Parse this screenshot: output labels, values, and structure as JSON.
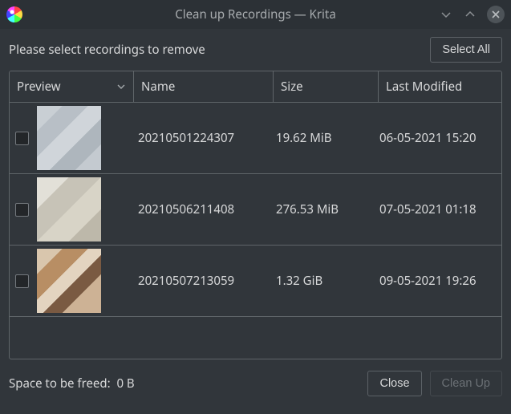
{
  "window": {
    "title": "Clean up Recordings — Krita"
  },
  "ui": {
    "instruction": "Please select recordings to remove",
    "select_all": "Select All",
    "close": "Close",
    "clean_up": "Clean Up",
    "space_label": "Space to be freed:",
    "space_value": "0 B"
  },
  "columns": {
    "preview": "Preview",
    "name": "Name",
    "size": "Size",
    "last_modified": "Last Modified"
  },
  "rows": [
    {
      "name": "20210501224307",
      "size": "19.62 MiB",
      "modified": "06-05-2021 15:20",
      "thumb_bg": "linear-gradient(135deg,#c9cfd4 0 20%,#b8bfc6 20% 40%,#d0d5da 40% 60%,#aeb6bd 60% 80%,#c4cad0 80% 100%)",
      "checked": false
    },
    {
      "name": "20210506211408",
      "size": "276.53 MiB",
      "modified": "07-05-2021 01:18",
      "thumb_bg": "linear-gradient(135deg,#e2e0d8 0 25%,#c7c3b7 25% 50%,#d8d4c7 50% 75%,#bdb8aa 75% 100%)",
      "checked": false
    },
    {
      "name": "20210507213059",
      "size": "1.32 GiB",
      "modified": "09-05-2021 19:26",
      "thumb_bg": "linear-gradient(135deg,#d9c6ad 0 20%,#b88e64 20% 40%,#e3d4c0 40% 55%,#7a5a42 55% 70%,#cdb295 70% 100%)",
      "checked": false
    }
  ]
}
